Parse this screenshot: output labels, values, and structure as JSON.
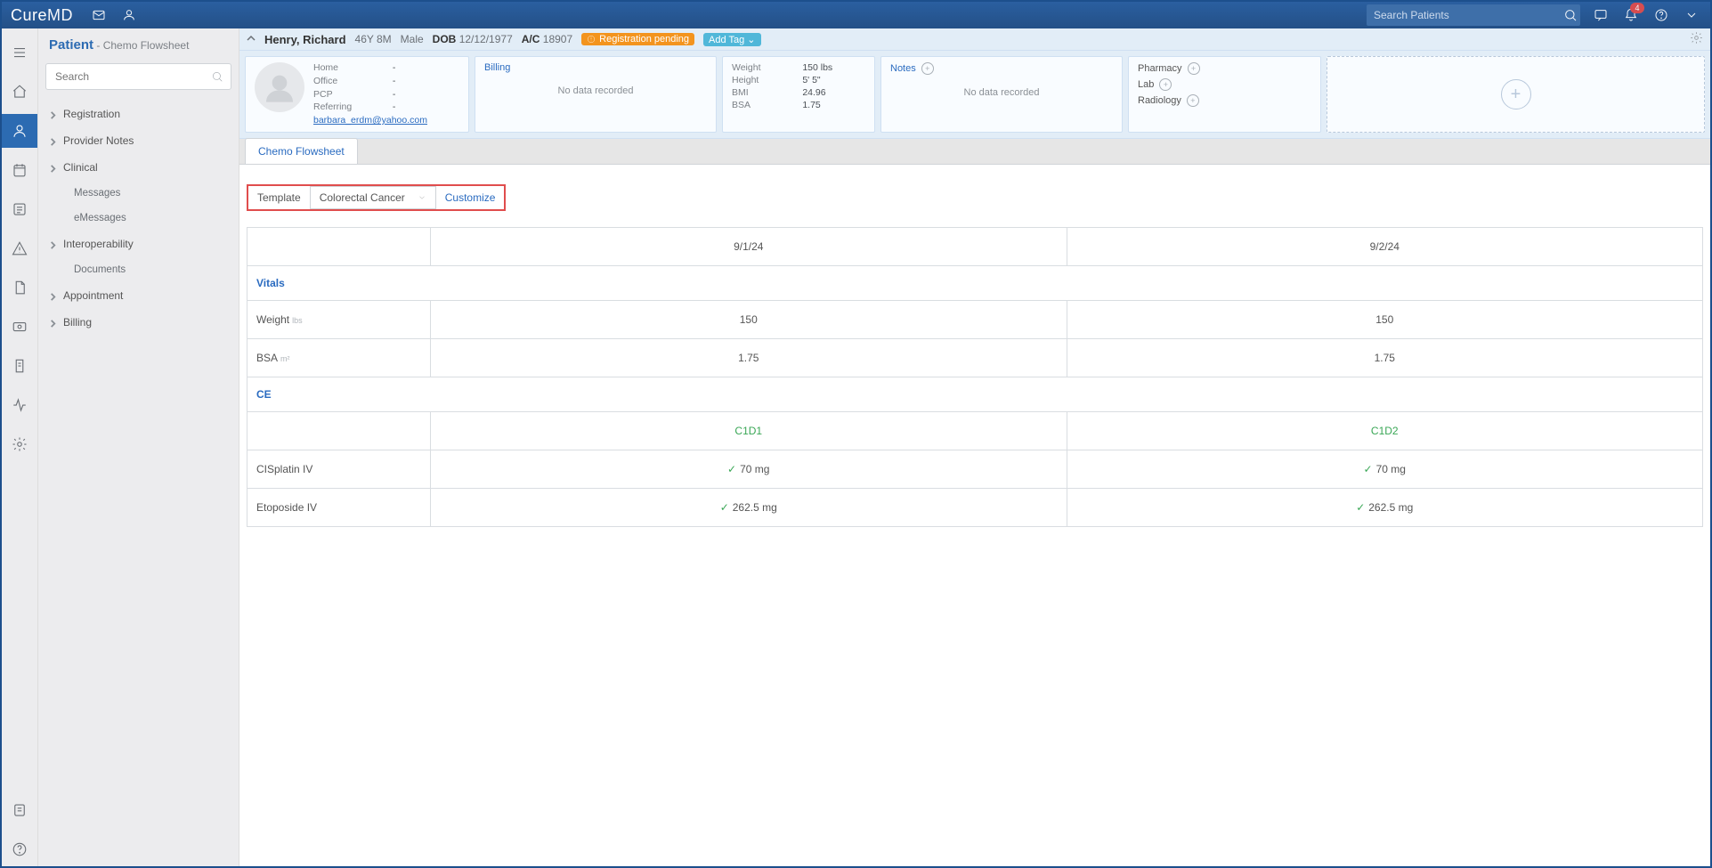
{
  "brand": {
    "pre": "Cure",
    "post": "MD"
  },
  "topbar": {
    "search_placeholder": "Search Patients",
    "notif_count": "4"
  },
  "sidenav": {
    "section": "Patient",
    "subsection": "Chemo Flowsheet",
    "search_placeholder": "Search",
    "items": [
      {
        "label": "Registration",
        "expand": true
      },
      {
        "label": "Provider Notes",
        "expand": true
      },
      {
        "label": "Clinical",
        "expand": true
      },
      {
        "label": "Messages",
        "child": true
      },
      {
        "label": "eMessages",
        "child": true
      },
      {
        "label": "Interoperability",
        "expand": true
      },
      {
        "label": "Documents",
        "child": true
      },
      {
        "label": "Appointment",
        "expand": true
      },
      {
        "label": "Billing",
        "expand": true
      }
    ]
  },
  "patient": {
    "name": "Henry, Richard",
    "age": "46Y 8M",
    "sex": "Male",
    "dob_label": "DOB",
    "dob": "12/12/1977",
    "ac_label": "A/C",
    "ac": "18907",
    "reg_status": "Registration pending",
    "addtag": "Add Tag"
  },
  "cards": {
    "contact": {
      "home_k": "Home",
      "home_v": "-",
      "office_k": "Office",
      "office_v": "-",
      "pcp_k": "PCP",
      "pcp_v": "-",
      "ref_k": "Referring",
      "ref_v": "-",
      "email": "barbara_erdm@yahoo.com"
    },
    "billing": {
      "title": "Billing",
      "ndr": "No data recorded"
    },
    "vitals": {
      "weight_k": "Weight",
      "weight_v": "150 lbs",
      "height_k": "Height",
      "height_v": "5' 5\"",
      "bmi_k": "BMI",
      "bmi_v": "24.96",
      "bsa_k": "BSA",
      "bsa_v": "1.75"
    },
    "notes": {
      "title": "Notes",
      "ndr": "No data recorded"
    },
    "links": {
      "pharmacy": "Pharmacy",
      "lab": "Lab",
      "radiology": "Radiology"
    }
  },
  "tab": {
    "label": "Chemo Flowsheet"
  },
  "template": {
    "label": "Template",
    "selected": "Colorectal Cancer",
    "customize": "Customize"
  },
  "table": {
    "dates": [
      "9/1/24",
      "9/2/24"
    ],
    "sections": {
      "vitals": {
        "label": "Vitals",
        "rows": [
          {
            "label": "Weight",
            "unit": "lbs",
            "vals": [
              "150",
              "150"
            ]
          },
          {
            "label": "BSA",
            "unit": "m²",
            "vals": [
              "1.75",
              "1.75"
            ]
          }
        ]
      },
      "ce": {
        "label": "CE",
        "cycles": [
          "C1D1",
          "C1D2"
        ],
        "rows": [
          {
            "label": "CISplatin IV",
            "vals": [
              "70 mg",
              "70 mg"
            ]
          },
          {
            "label": "Etoposide IV",
            "vals": [
              "262.5 mg",
              "262.5 mg"
            ]
          }
        ]
      }
    }
  }
}
